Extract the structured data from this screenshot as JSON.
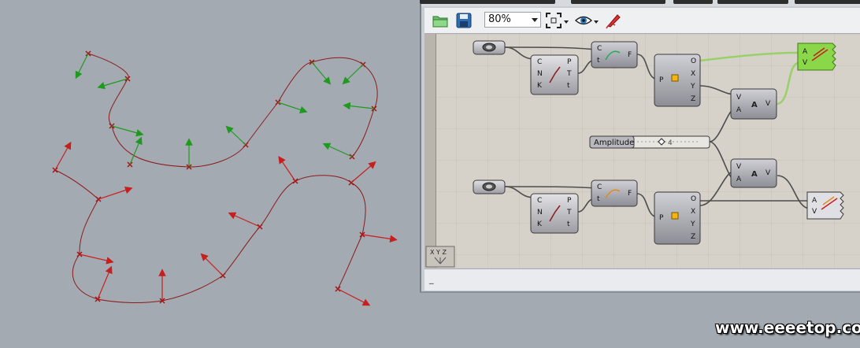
{
  "toolbar": {
    "zoom_value": "80%",
    "open_icon": "folder-icon",
    "save_icon": "floppy-disk-icon",
    "zoom_extents_icon": "zoom-extents-icon",
    "preview_icon": "eye-icon",
    "sketch_icon": "pencil-icon"
  },
  "canvas": {
    "slider_label": "Amplitude",
    "slider_value": "4",
    "xyz_widget_label": "X Y Z"
  },
  "nodes": {
    "curve_param_inputs": [
      "C",
      "N",
      "K"
    ],
    "curve_param_outputs": [
      "P",
      "T",
      "t"
    ],
    "eval_inputs": [
      "C",
      "t"
    ],
    "eval_output": "F",
    "deconstruct_input": "P",
    "deconstruct_outputs": [
      "O",
      "X",
      "Y",
      "Z"
    ],
    "amplitude_inputs": [
      "V",
      "A"
    ],
    "amplitude_output": "V",
    "vector_display_inputs": [
      "A",
      "V"
    ]
  },
  "statusbar": {
    "text": "_"
  },
  "watermark": "www.eeeetop.com",
  "colors": {
    "viewport_bg": "#a3aab2",
    "curve_red": "#8b1b1b",
    "vector_green": "#1e9b1e",
    "vector_red": "#c81e1e",
    "canvas_bg": "#d6d1c9",
    "wire_green": "#9ad06a"
  }
}
